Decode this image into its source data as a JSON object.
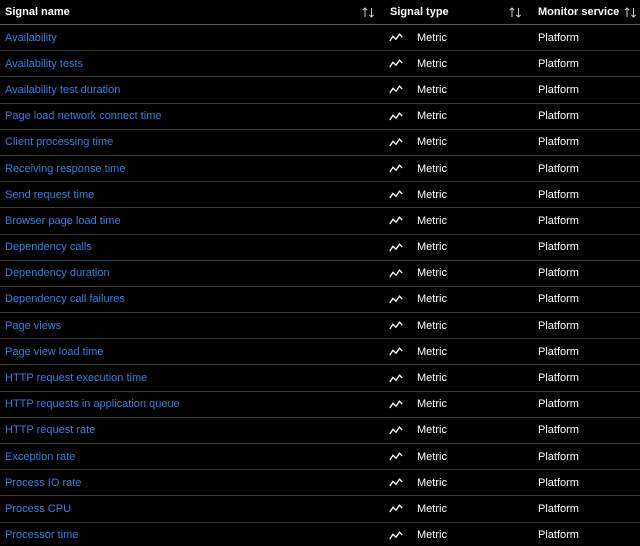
{
  "header": {
    "signal_name": "Signal name",
    "signal_type": "Signal type",
    "monitor_service": "Monitor service"
  },
  "icons": {
    "sort": "sort-arrows-icon",
    "metric": "metric-line-icon"
  },
  "colors": {
    "link": "#2f7fe0",
    "background": "#000000",
    "text": "#ffffff",
    "divider": "#3a3a3a"
  },
  "rows": [
    {
      "name": "Availability",
      "type": "Metric",
      "monitor": "Platform"
    },
    {
      "name": "Availability tests",
      "type": "Metric",
      "monitor": "Platform"
    },
    {
      "name": "Availability test duration",
      "type": "Metric",
      "monitor": "Platform"
    },
    {
      "name": "Page load network connect time",
      "type": "Metric",
      "monitor": "Platform"
    },
    {
      "name": "Client processing time",
      "type": "Metric",
      "monitor": "Platform"
    },
    {
      "name": "Receiving response time",
      "type": "Metric",
      "monitor": "Platform"
    },
    {
      "name": "Send request time",
      "type": "Metric",
      "monitor": "Platform"
    },
    {
      "name": "Browser page load time",
      "type": "Metric",
      "monitor": "Platform"
    },
    {
      "name": "Dependency calls",
      "type": "Metric",
      "monitor": "Platform"
    },
    {
      "name": "Dependency duration",
      "type": "Metric",
      "monitor": "Platform"
    },
    {
      "name": "Dependency call failures",
      "type": "Metric",
      "monitor": "Platform"
    },
    {
      "name": "Page views",
      "type": "Metric",
      "monitor": "Platform"
    },
    {
      "name": "Page view load time",
      "type": "Metric",
      "monitor": "Platform"
    },
    {
      "name": "HTTP request execution time",
      "type": "Metric",
      "monitor": "Platform"
    },
    {
      "name": "HTTP requests in application queue",
      "type": "Metric",
      "monitor": "Platform"
    },
    {
      "name": "HTTP request rate",
      "type": "Metric",
      "monitor": "Platform"
    },
    {
      "name": "Exception rate",
      "type": "Metric",
      "monitor": "Platform"
    },
    {
      "name": "Process IO rate",
      "type": "Metric",
      "monitor": "Platform"
    },
    {
      "name": "Process CPU",
      "type": "Metric",
      "monitor": "Platform"
    },
    {
      "name": "Processor time",
      "type": "Metric",
      "monitor": "Platform"
    }
  ]
}
